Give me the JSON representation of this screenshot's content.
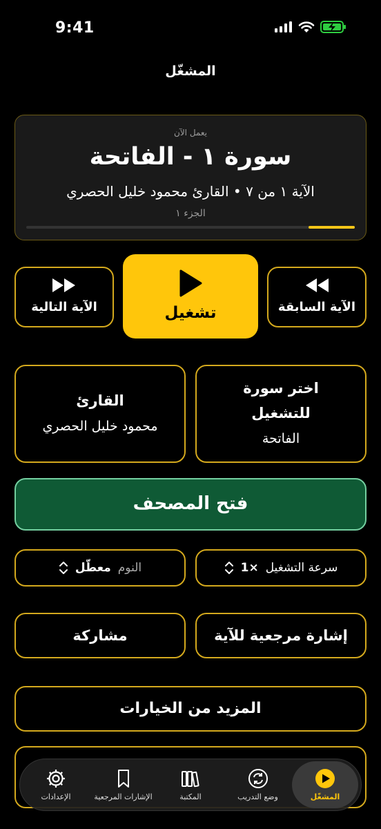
{
  "status_bar": {
    "time": "9:41"
  },
  "nav": {
    "title": "المشغّل"
  },
  "now_playing": {
    "label": "يعمل الآن",
    "title": "سورة ١ - الفاتحة",
    "meta": "الآية ١ من ٧  •  القارئ محمود خليل الحصري",
    "juz": "الجزء ١",
    "progress_fraction": 0.14
  },
  "controls": {
    "previous_label": "الآية السابقة",
    "play_label": "تشغيل",
    "next_label": "الآية التالية"
  },
  "selectors": {
    "surah": {
      "title": "اختر سورة للتشغيل",
      "value": "الفاتحة"
    },
    "reciter": {
      "title": "القارئ",
      "value": "محمود خليل الحصري"
    }
  },
  "mushaf_button": "فتح المصحف",
  "options": {
    "speed": {
      "label": "سرعة التشغيل",
      "value": "1×"
    },
    "sleep": {
      "label": "النوم",
      "value": "معطّل"
    }
  },
  "actions": {
    "bookmark": "إشارة مرجعية للآية",
    "share": "مشاركة",
    "more": "المزيد من الخيارات"
  },
  "tab_bar": {
    "items": [
      {
        "label": "المشغّل",
        "icon": "play-circle-icon",
        "active": true
      },
      {
        "label": "وضع التدريب",
        "icon": "repeat-icon",
        "active": false
      },
      {
        "label": "المكتبة",
        "icon": "library-icon",
        "active": false
      },
      {
        "label": "الإشارات المرجعية",
        "icon": "bookmark-icon",
        "active": false
      },
      {
        "label": "الإعدادات",
        "icon": "gear-icon",
        "active": false
      }
    ]
  },
  "colors": {
    "accent": "#ffc60b",
    "border": "#d4a91d",
    "mushaf_bg": "#0f5a35",
    "mushaf_border": "#74cfa0",
    "background": "#000000"
  }
}
